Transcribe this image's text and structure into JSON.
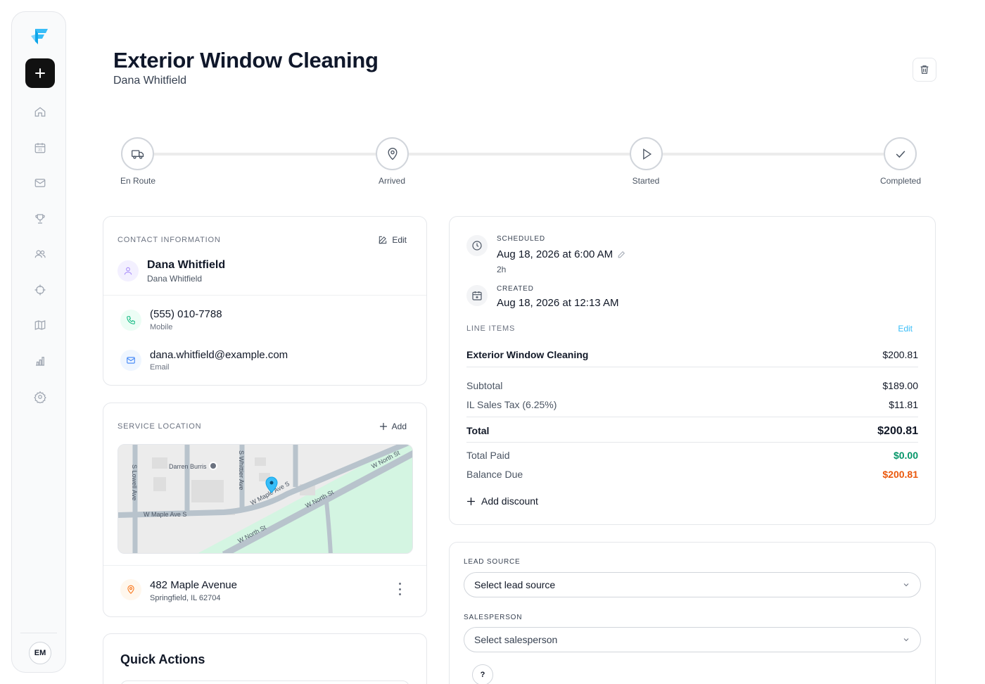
{
  "sidebar": {
    "nav": [
      "home-icon",
      "calendar-icon",
      "mail-icon",
      "trophy-icon",
      "users-icon",
      "crosshair-icon",
      "map-icon",
      "bar-chart-icon",
      "gear-icon"
    ],
    "avatar_initials": "EM"
  },
  "header": {
    "title": "Exterior Window Cleaning",
    "subtitle": "Dana Whitfield"
  },
  "progress": {
    "steps": [
      {
        "label": "En Route",
        "icon": "truck-icon"
      },
      {
        "label": "Arrived",
        "icon": "map-pin-icon"
      },
      {
        "label": "Started",
        "icon": "play-icon"
      },
      {
        "label": "Completed",
        "icon": "check-icon"
      }
    ]
  },
  "contact": {
    "section_label": "CONTACT INFORMATION",
    "edit_label": "Edit",
    "name": "Dana Whitfield",
    "name_sub": "Dana Whitfield",
    "phone": "(555) 010-7788",
    "phone_type": "Mobile",
    "email": "dana.whitfield@example.com",
    "email_type": "Email"
  },
  "location": {
    "section_label": "SERVICE LOCATION",
    "add_label": "Add",
    "street": "482 Maple Avenue",
    "city": "Springfield, IL 62704",
    "map_labels": {
      "poi": "Darren Burris",
      "s_lowell": "S Lowell Ave",
      "s_whittier": "S Whittier Ave",
      "maple_left": "W Maple Ave S",
      "maple_right": "W Maple Ave S",
      "north_top": "W North St",
      "north_mid": "W North St",
      "north_bottom": "W North St"
    }
  },
  "quick_actions": {
    "title": "Quick Actions"
  },
  "schedule": {
    "scheduled_label": "SCHEDULED",
    "scheduled_value": "Aug 18, 2026 at 6:00 AM",
    "duration": "2h",
    "created_label": "CREATED",
    "created_value": "Aug 18, 2026 at 12:13 AM"
  },
  "line_items": {
    "section_label": "LINE ITEMS",
    "edit_label": "Edit",
    "items": [
      {
        "name": "Exterior Window Cleaning",
        "amount": "$200.81"
      }
    ],
    "subtotal_label": "Subtotal",
    "subtotal": "$189.00",
    "tax_label": "IL Sales Tax (6.25%)",
    "tax": "$11.81",
    "total_label": "Total",
    "total": "$200.81",
    "paid_label": "Total Paid",
    "paid": "$0.00",
    "balance_label": "Balance Due",
    "balance": "$200.81",
    "add_discount": "Add discount"
  },
  "lead": {
    "lead_source_label": "LEAD SOURCE",
    "lead_source_value": "Select lead source",
    "salesperson_label": "SALESPERSON",
    "salesperson_value": "Select salesperson",
    "help_label": "?"
  },
  "colors": {
    "accent": "#38bdf8",
    "paid_green": "#059669",
    "balance_orange": "#ea580c",
    "map_green": "#d4f5e2"
  }
}
